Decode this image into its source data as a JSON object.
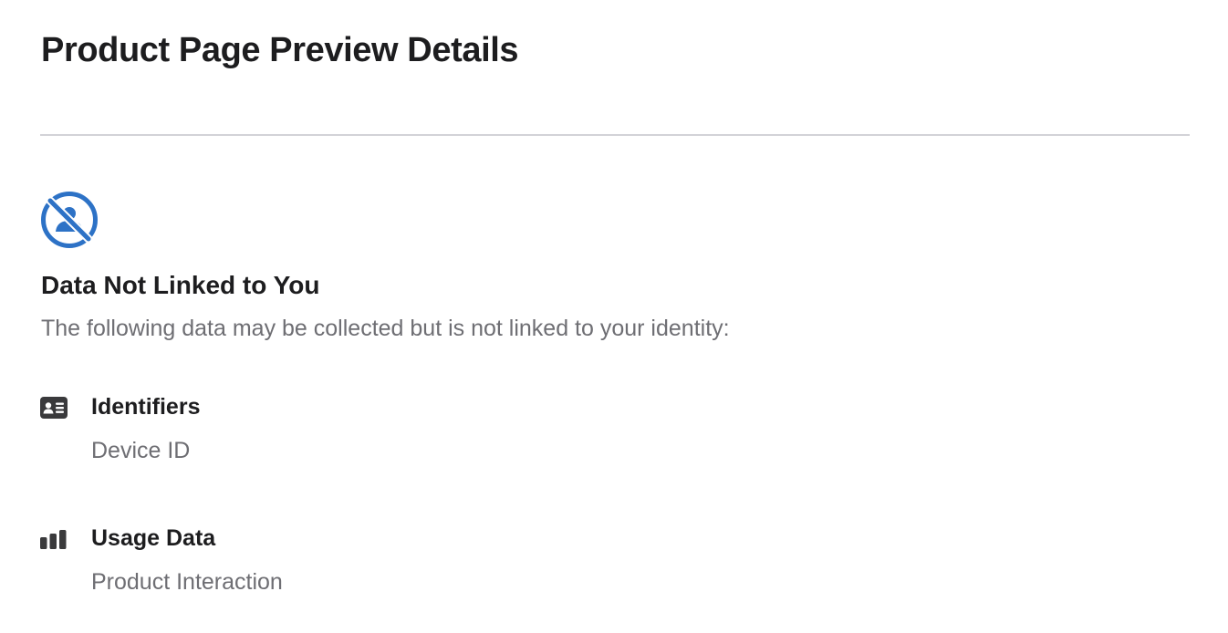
{
  "page": {
    "title": "Product Page Preview Details"
  },
  "privacy_section": {
    "icon": "person-crossed-circle-icon",
    "icon_color": "#2d72c6",
    "title": "Data Not Linked to You",
    "description": "The following data may be collected but is not linked to your identity:",
    "categories": [
      {
        "icon": "id-card-icon",
        "title": "Identifiers",
        "items": [
          "Device ID"
        ]
      },
      {
        "icon": "bar-chart-icon",
        "title": "Usage Data",
        "items": [
          "Product Interaction"
        ]
      }
    ]
  }
}
